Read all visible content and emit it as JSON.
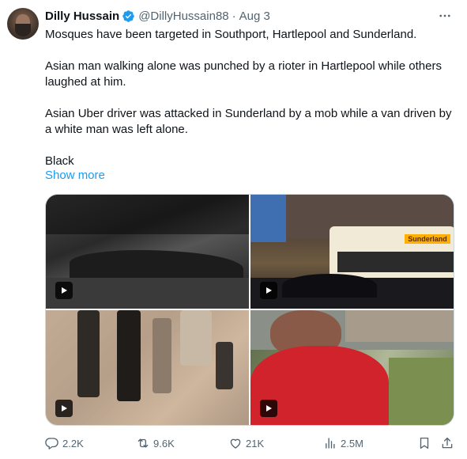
{
  "tweet": {
    "author_name": "Dilly Hussain",
    "handle": "@DillyHussain88",
    "separator": "·",
    "date": "Aug 3",
    "paragraphs": [
      "Mosques have been targeted in Southport, Hartlepool and Sunderland.",
      "Asian man walking alone was punched by a rioter in Hartlepool while others laughed at him.",
      "Asian Uber driver was attacked in Sunderland by a mob while a van driven by a white man was left alone.",
      "Black"
    ],
    "show_more_label": "Show more"
  },
  "media": {
    "items": [
      {
        "type": "video",
        "icon": "play-icon"
      },
      {
        "type": "video",
        "icon": "play-icon"
      },
      {
        "type": "video",
        "icon": "play-icon"
      },
      {
        "type": "video",
        "icon": "play-icon"
      }
    ],
    "bus_sign_text": "Sunderland"
  },
  "actions": {
    "reply_count": "2.2K",
    "repost_count": "9.6K",
    "like_count": "21K",
    "views_count": "2.5M"
  },
  "icons": {
    "verified": "verified-badge-icon",
    "more": "more-dots-icon",
    "reply": "reply-icon",
    "repost": "repost-icon",
    "like": "heart-icon",
    "views": "views-icon",
    "bookmark": "bookmark-icon",
    "share": "share-icon"
  },
  "colors": {
    "text": "#0f1419",
    "secondary": "#536471",
    "link": "#1d9bf0",
    "verified": "#1d9bf0",
    "border": "#cfd9de"
  }
}
